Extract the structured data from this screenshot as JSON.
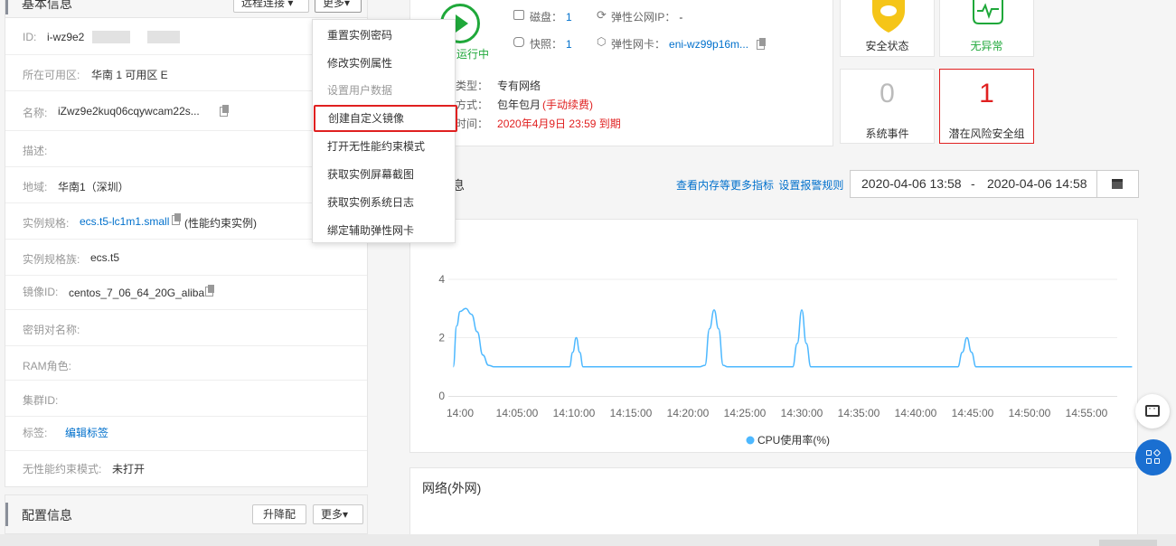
{
  "basic_info": {
    "title": "基本信息",
    "remote_connect": "远程连接 ▾",
    "more": "更多▾",
    "rows": [
      {
        "label": "ID:",
        "value": "i-wz9e2"
      },
      {
        "label": "所在可用区:",
        "value": "华南 1 可用区 E"
      },
      {
        "label": "名称:",
        "value": "iZwz9e2kuq06cqywcam22s..."
      },
      {
        "label": "描述:",
        "value": ""
      },
      {
        "label": "地域:",
        "value": "华南1（深圳）"
      },
      {
        "label": "实例规格:",
        "value": "ecs.t5-lc1m1.small",
        "value2": "(性能约束实例)"
      },
      {
        "label": "实例规格族:",
        "value": "ecs.t5"
      },
      {
        "label": "镜像ID:",
        "value": "centos_7_06_64_20G_aliba..."
      },
      {
        "label": "密钥对名称:",
        "value": ""
      },
      {
        "label": "RAM角色:",
        "value": ""
      },
      {
        "label": "集群ID:",
        "value": ""
      },
      {
        "label": "标签:",
        "value": "编辑标签"
      },
      {
        "label": "无性能约束模式:",
        "value": "未打开"
      }
    ]
  },
  "config_info": {
    "title": "配置信息",
    "upgrade": "升降配",
    "more": "更多▾"
  },
  "dropdown": {
    "items": [
      "重置实例密码",
      "修改实例属性",
      "设置用户数据",
      "创建自定义镜像",
      "打开无性能约束模式",
      "获取实例屏幕截图",
      "获取实例系统日志",
      "绑定辅助弹性网卡"
    ]
  },
  "status": {
    "running": "运行中",
    "disk_label": "磁盘：",
    "disk_value": "1",
    "snapshot_label": "快照：",
    "snapshot_value": "1",
    "eip_label": "弹性公网IP：",
    "eip_value": "-",
    "eni_label": "弹性网卡：",
    "eni_value": "eni-wz99p16m...",
    "network_type_label": "类型：",
    "network_type_value": "专有网络",
    "billing_label": "方式：",
    "billing_value": "包年包月",
    "billing_note": "(手动续费)",
    "expire_label": "时间：",
    "expire_value": "2020年4月9日 23:59 到期"
  },
  "cards": {
    "security_status": "安全状态",
    "no_anomaly": "无异常",
    "system_events_count": "0",
    "system_events": "系统事件",
    "risk_groups_count": "1",
    "risk_groups": "潜在风险安全组"
  },
  "monitor": {
    "title_fragment": "息",
    "more_metrics": "查看内存等更多指标",
    "set_alarm": "设置报警规则",
    "date_start": "2020-04-06 13:58",
    "date_sep": "-",
    "date_end": "2020-04-06 14:58"
  },
  "network": {
    "title": "网络(外网)"
  },
  "chart_data": {
    "type": "line",
    "title": "",
    "xlabel": "",
    "ylabel": "",
    "ylim": [
      0,
      4
    ],
    "yticks": [
      "0",
      "2",
      "4"
    ],
    "x_tick_labels": [
      "14:00",
      "14:05:00",
      "14:10:00",
      "14:15:00",
      "14:20:00",
      "14:25:00",
      "14:30:00",
      "14:35:00",
      "14:40:00",
      "14:45:00",
      "14:50:00",
      "14:55:00"
    ],
    "series": [
      {
        "name": "CPU使用率(%)",
        "color": "#4db8ff",
        "points": [
          [
            -0.6,
            1.0
          ],
          [
            -0.3,
            2.4
          ],
          [
            0.0,
            2.9
          ],
          [
            0.5,
            3.0
          ],
          [
            1.0,
            2.8
          ],
          [
            1.5,
            2.2
          ],
          [
            2.0,
            1.4
          ],
          [
            2.5,
            1.05
          ],
          [
            3.0,
            1.0
          ],
          [
            8.0,
            1.0
          ],
          [
            9.0,
            1.0
          ],
          [
            9.6,
            1.0
          ],
          [
            9.9,
            1.5
          ],
          [
            10.2,
            2.0
          ],
          [
            10.5,
            1.5
          ],
          [
            10.8,
            1.0
          ],
          [
            20.0,
            1.0
          ],
          [
            21.0,
            1.0
          ],
          [
            21.5,
            1.05
          ],
          [
            21.9,
            2.3
          ],
          [
            22.3,
            2.95
          ],
          [
            22.7,
            2.3
          ],
          [
            23.1,
            1.05
          ],
          [
            23.5,
            1.0
          ],
          [
            25.0,
            1.0
          ],
          [
            29.2,
            1.0
          ],
          [
            29.6,
            1.8
          ],
          [
            30.0,
            2.95
          ],
          [
            30.4,
            1.8
          ],
          [
            30.8,
            1.0
          ],
          [
            40.0,
            1.0
          ],
          [
            43.7,
            1.0
          ],
          [
            44.1,
            1.5
          ],
          [
            44.5,
            2.0
          ],
          [
            44.9,
            1.5
          ],
          [
            45.3,
            1.0
          ],
          [
            50.0,
            1.0
          ],
          [
            59.0,
            1.0
          ]
        ]
      }
    ],
    "legend": "bottom"
  },
  "icons": {
    "running": "play-circle-icon",
    "disk": "disk-icon",
    "snapshot": "camera-icon",
    "eip": "link-icon",
    "eni": "network-card-icon",
    "security": "shield-icon",
    "heartbeat": "heartbeat-icon",
    "calendar": "calendar-icon",
    "chat": "chat-icon",
    "apps": "apps-icon"
  },
  "colors": {
    "accent": "#0070cc",
    "running": "#1fa83a",
    "warning": "#e02020",
    "shield": "#f5c518"
  }
}
